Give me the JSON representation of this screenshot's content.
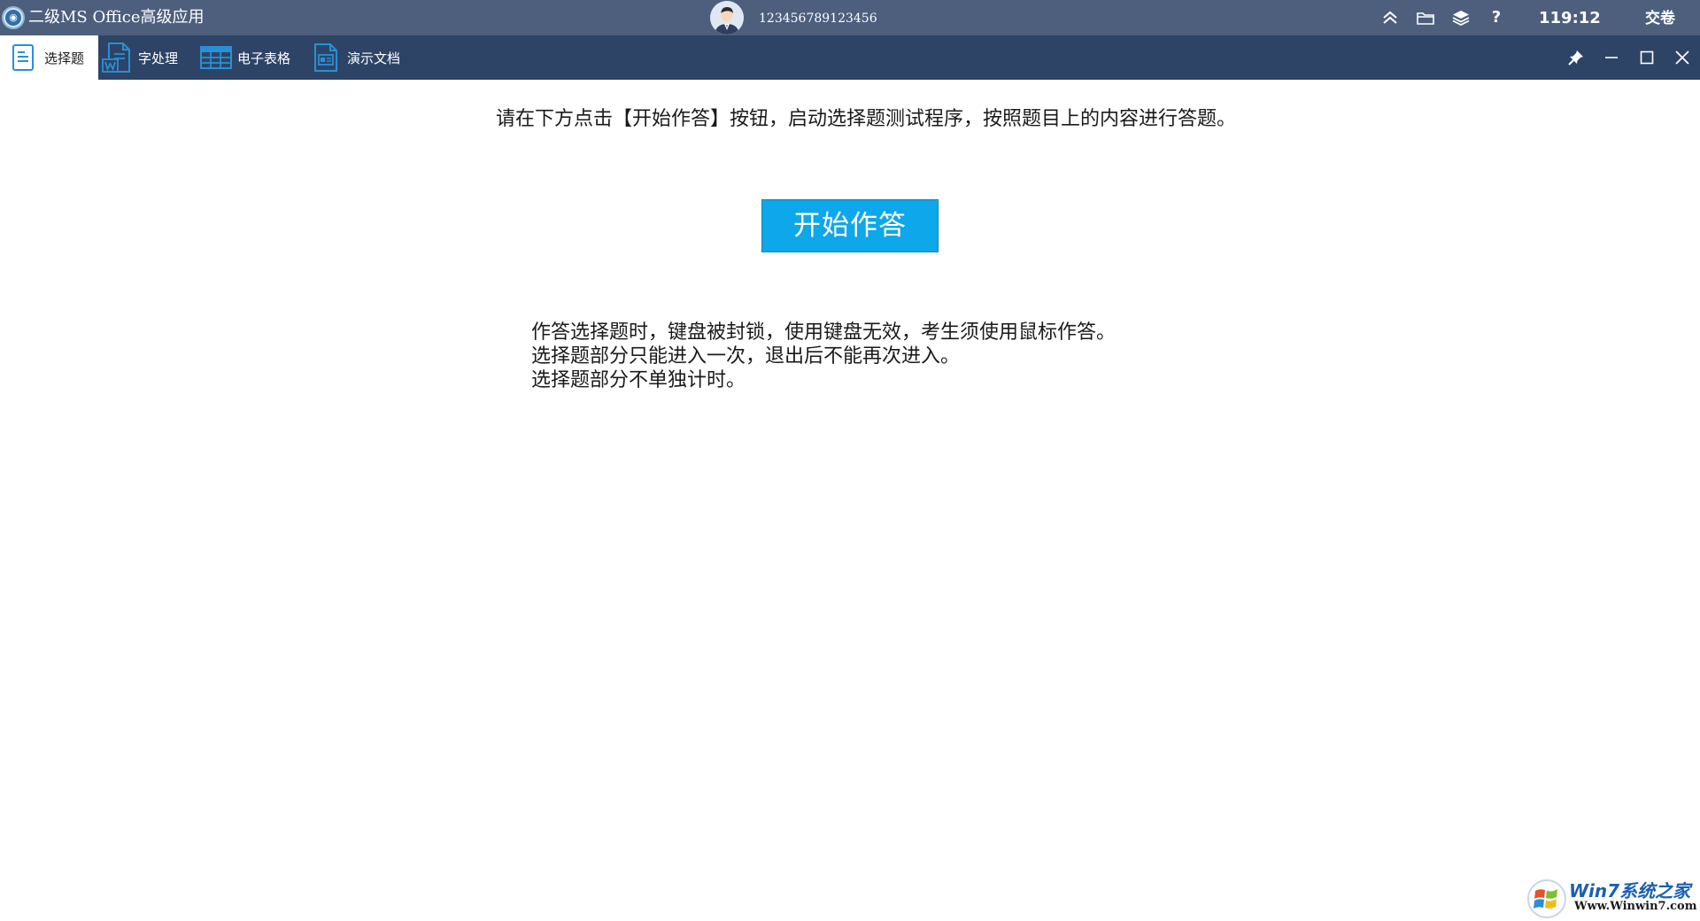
{
  "titlebar": {
    "app_title": "二级MS Office高级应用",
    "user_id": "123456789123456",
    "timer": "119:12",
    "submit_label": "交卷",
    "help_label": "?"
  },
  "tabs": [
    {
      "label": "选择题",
      "icon": "document-lines-icon",
      "active": true
    },
    {
      "label": "字处理",
      "icon": "word-document-icon",
      "active": false
    },
    {
      "label": "电子表格",
      "icon": "spreadsheet-icon",
      "active": false
    },
    {
      "label": "演示文档",
      "icon": "presentation-icon",
      "active": false
    }
  ],
  "content": {
    "instruction": "请在下方点击【开始作答】按钮，启动选择题测试程序，按照题目上的内容进行答题。",
    "start_button": "开始作答",
    "notes": [
      "作答选择题时，键盘被封锁，使用键盘无效，考生须使用鼠标作答。",
      "选择题部分只能进入一次，退出后不能再次进入。",
      "选择题部分不单独计时。"
    ]
  },
  "watermark": {
    "brand": "Win7系统之家",
    "url": "Www.Winwin7.com"
  },
  "colors": {
    "titlebar_bg": "#4d5f7d",
    "tabbar_bg": "#2d4466",
    "start_button_bg": "#0da7ea",
    "icon_blue": "#2a8fd6"
  }
}
